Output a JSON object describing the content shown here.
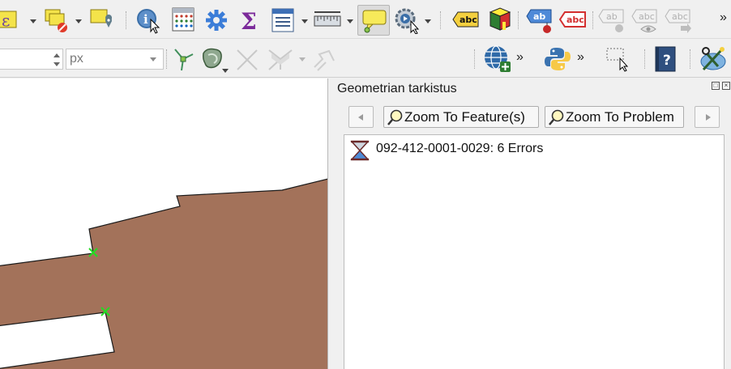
{
  "toolbar_top": {
    "icons": [
      "expression-select-icon",
      "deselect-features-icon",
      "select-by-location-icon",
      "identify-features-icon",
      "open-attribute-table-icon",
      "processing-toolbox-icon",
      "statistical-summary-icon",
      "field-calculator-icon",
      "measure-icon",
      "map-tips-icon",
      "temporal-controller-icon",
      "layer-labeling-icon",
      "label-diagram-icon",
      "pin-labels-icon",
      "highlight-labels-icon",
      "show-hide-labels-icon",
      "preview-labels-icon",
      "move-label-icon",
      "more-tools-chevron-icon"
    ],
    "overflow": "»"
  },
  "toolbar_second": {
    "line_width_value": "",
    "unit_value": "px",
    "overflow": "»",
    "icons": [
      "vertex-tool-icon",
      "reshape-feature-icon",
      "split-feature-icon",
      "merge-features-icon",
      "offset-curve-icon",
      "geometry-checker-icon",
      "python-console-icon",
      "select-rectangle-icon",
      "help-book-icon",
      "settings-wrench-icon"
    ]
  },
  "map": {
    "fill_color": "#a3725a",
    "marker_color": "#22dd22"
  },
  "dock": {
    "title": "Geometrian tarkistus",
    "zoom_feature_label": "Zoom To Feature(s)",
    "zoom_problem_label": "Zoom To Problem",
    "result_item": "092-412-0001-0029: 6 Errors"
  }
}
